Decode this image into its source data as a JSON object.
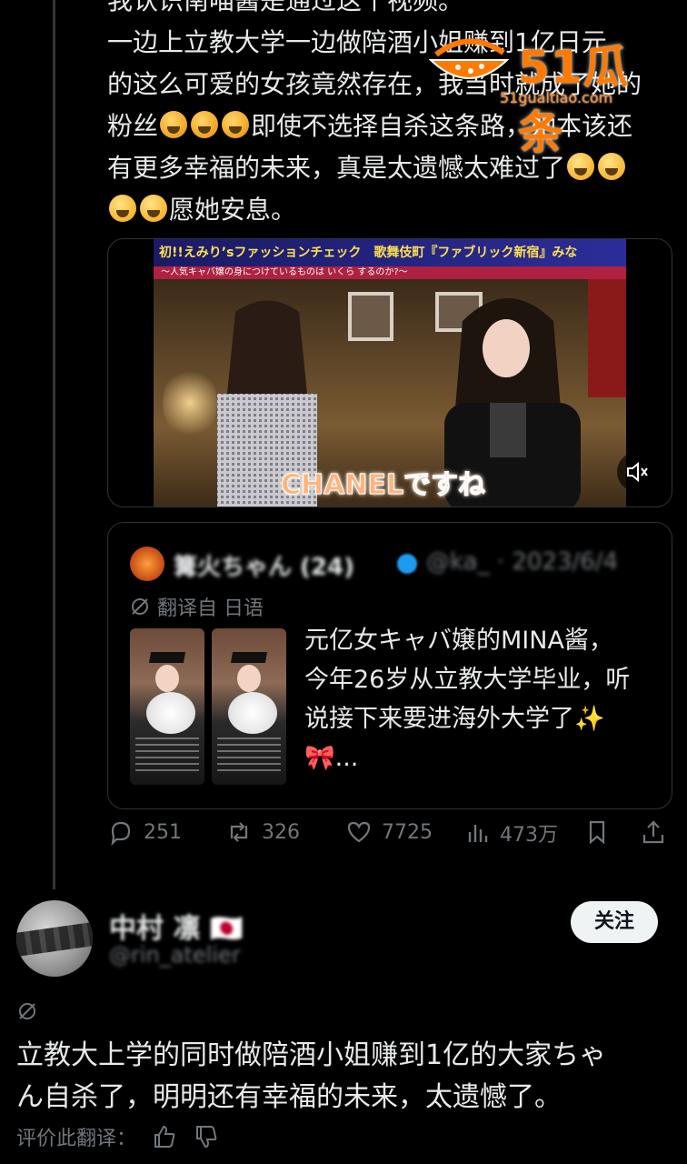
{
  "post": {
    "lines": [
      "我认识南喵酱是通过这个视频。",
      "一边上立教大学一边做陪酒小姐赚到1亿日元",
      "的这么可爱的女孩竟然存在，我当时就成了她的",
      "粉丝",
      "即使不选择自杀这条路，她本该还",
      "有更多幸福的未来，真是太遗憾太难过了",
      "愿她安息。"
    ]
  },
  "watermark": {
    "brand": "51瓜条",
    "url": "51gualtiao.com"
  },
  "video": {
    "banner": "初!!えみりʼsファッションチェック　歌舞伎町『ファブリック新宿』みな",
    "subbanner": "～人気キャバ嬢の身につけているものは いくら するのか?～",
    "caption": "CHANELですね",
    "mute_icon": "speaker-muted-icon"
  },
  "quote": {
    "name": "篝火ちゃん (24)",
    "handle": "@ka_ · 2023/6/4",
    "translate_label": "翻译自 日语",
    "body_lines": [
      "元亿女キャバ嬢的MINA酱，",
      "今年26岁从立教大学毕业，听",
      "说接下来要进海外大学了✨",
      "🎀..."
    ]
  },
  "actions": {
    "replies": "251",
    "reposts": "326",
    "likes": "7725",
    "views": "473万"
  },
  "reply": {
    "name": "中村 凛 🇯🇵",
    "handle": "@rin_atelier",
    "follow_label": "关注",
    "text_lines": [
      "立教大上学的同时做陪酒小姐赚到1亿的大家ちゃ",
      "ん自杀了，明明还有幸福的未来，太遗憾了。"
    ],
    "rate_label": "评价此翻译："
  },
  "colors": {
    "background": "#000000",
    "text": "#e7e9ea",
    "muted": "#71767b",
    "border": "#2f3336",
    "accent_watermark": "#ff7a00"
  }
}
